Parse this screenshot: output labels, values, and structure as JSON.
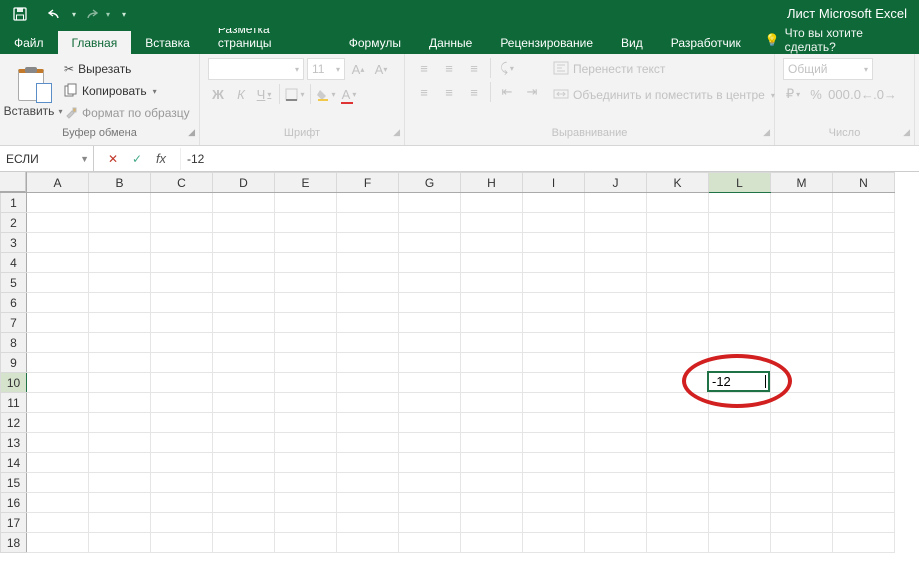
{
  "title": "Лист Microsoft Excel",
  "qat": {
    "save": "save",
    "undo": "undo",
    "redo": "redo"
  },
  "tabs": [
    "Файл",
    "Главная",
    "Вставка",
    "Разметка страницы",
    "Формулы",
    "Данные",
    "Рецензирование",
    "Вид",
    "Разработчик"
  ],
  "active_tab": 1,
  "tell_me": "Что вы хотите сделать?",
  "ribbon": {
    "paste": "Вставить",
    "cut": "Вырезать",
    "copy": "Копировать",
    "fmtpainter": "Формат по образцу",
    "clipboard_title": "Буфер обмена",
    "font_name": "",
    "font_size": "11",
    "font_title": "Шрифт",
    "wrap": "Перенести текст",
    "merge": "Объединить и поместить в центре",
    "align_title": "Выравнивание",
    "num_format": "Общий",
    "num_title": "Число"
  },
  "name_box": "ЕСЛИ",
  "formula": "-12",
  "columns": [
    "A",
    "B",
    "C",
    "D",
    "E",
    "F",
    "G",
    "H",
    "I",
    "J",
    "K",
    "L",
    "M",
    "N"
  ],
  "rows": 18,
  "selected": {
    "col": "L",
    "row": 10,
    "value": "-12"
  },
  "colors": {
    "brand": "#0e6837",
    "anno": "#d21f1f"
  }
}
